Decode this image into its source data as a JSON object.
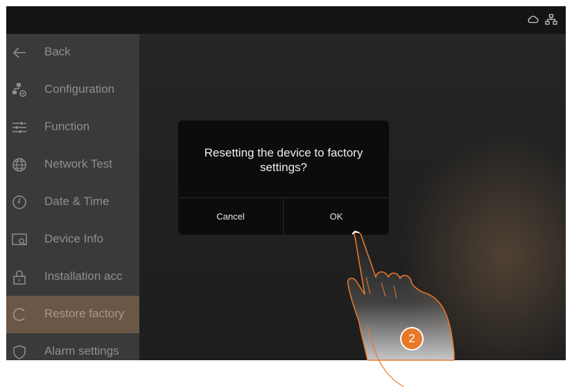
{
  "sidebar": {
    "items": [
      {
        "label": "Back",
        "icon": "arrow-left-icon"
      },
      {
        "label": "Configuration",
        "icon": "network-config-icon"
      },
      {
        "label": "Function",
        "icon": "sliders-icon"
      },
      {
        "label": "Network Test",
        "icon": "globe-icon"
      },
      {
        "label": "Date & Time",
        "icon": "clock-icon"
      },
      {
        "label": "Device Info",
        "icon": "device-info-icon"
      },
      {
        "label": "Installation acc",
        "icon": "lock-icon"
      },
      {
        "label": "Restore factory",
        "icon": "restore-icon"
      },
      {
        "label": "Alarm settings",
        "icon": "shield-icon"
      }
    ],
    "active_index": 7
  },
  "statusbar": {
    "icons": [
      "cloud-icon",
      "network-icon"
    ]
  },
  "dialog": {
    "message": "Resetting the device to factory settings?",
    "cancel_label": "Cancel",
    "ok_label": "OK"
  },
  "annotation": {
    "step": "2",
    "accent": "#e8782a"
  }
}
